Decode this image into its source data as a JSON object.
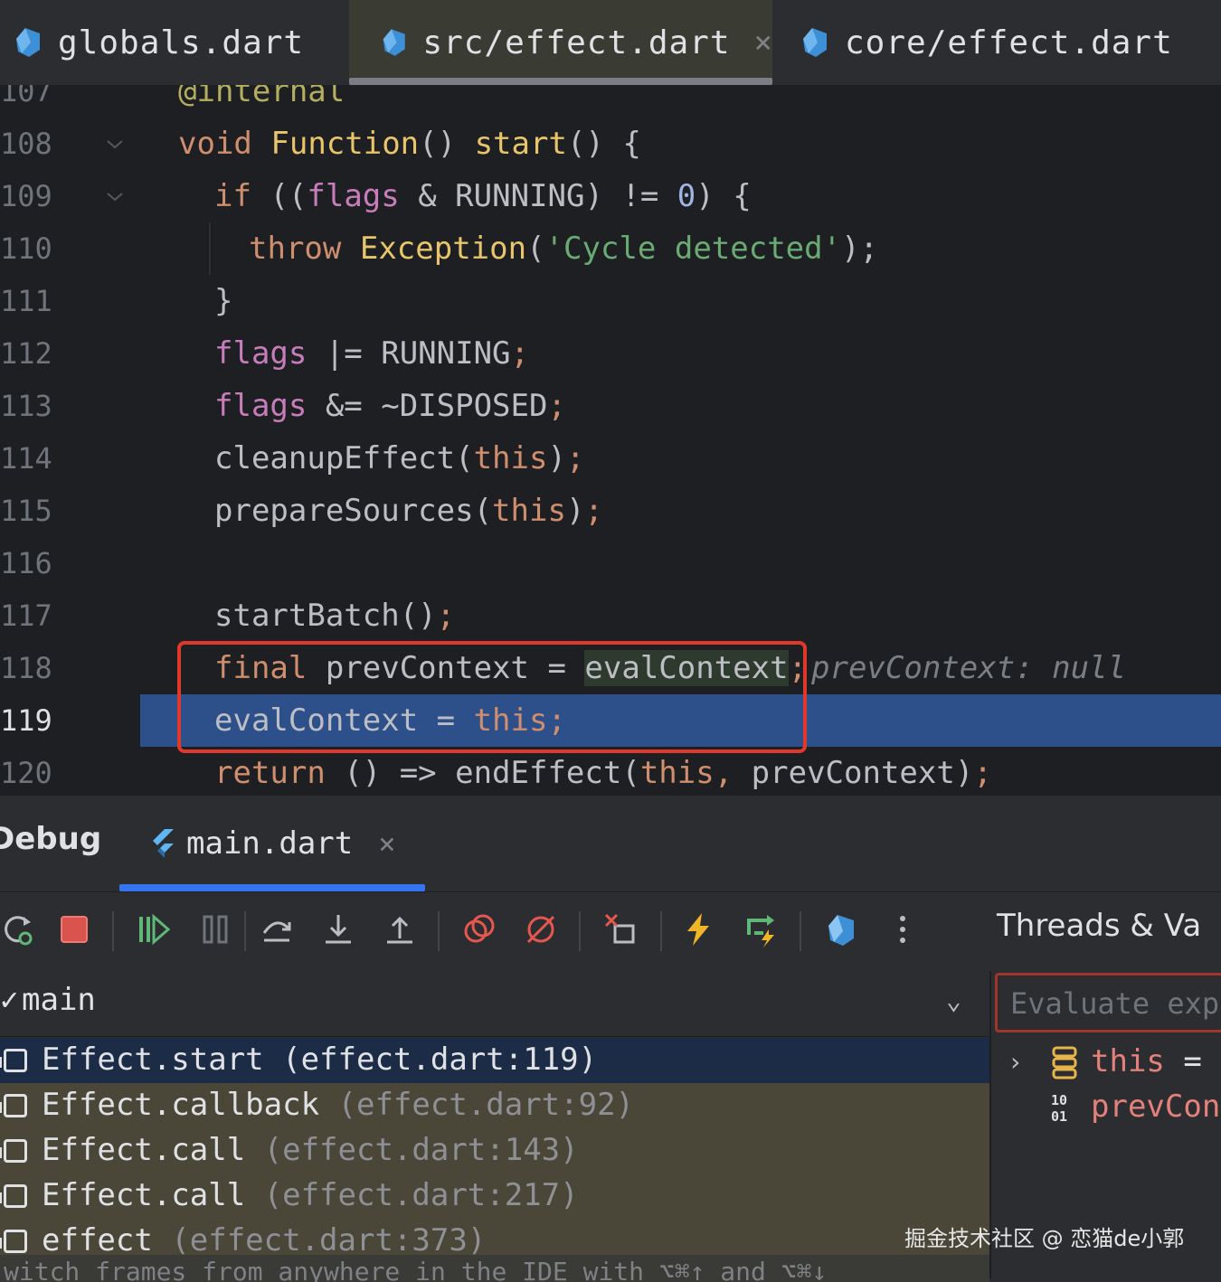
{
  "editor_tabs": [
    {
      "label": "globals.dart",
      "active": false
    },
    {
      "label": "src/effect.dart",
      "active": true,
      "close": "×"
    },
    {
      "label": "core/effect.dart",
      "active": false
    }
  ],
  "gutter": {
    "lines": [
      "107",
      "108",
      "109",
      "110",
      "111",
      "112",
      "113",
      "114",
      "115",
      "116",
      "117",
      "118",
      "119",
      "120"
    ],
    "current_line": "119"
  },
  "code": {
    "l107": {
      "ann": "@internal"
    },
    "l108": {
      "kw": "void",
      "type": "Function",
      "paren": "()",
      "fn": "start",
      "rest": "() {"
    },
    "l109": {
      "kw": "if",
      "p1": "((",
      "fld": "flags",
      "op": " & RUNNING) != ",
      "num": "0",
      "rest": ") {"
    },
    "l110": {
      "kw": "throw",
      "type": "Exception",
      "p1": "(",
      "str": "'Cycle detected'",
      "rest": ");"
    },
    "l111": {
      "text": "}"
    },
    "l112": {
      "fld": "flags",
      "rest": " |= RUNNING",
      "semi": ";"
    },
    "l113": {
      "fld": "flags",
      "rest": " &= ~DISPOSED",
      "semi": ";"
    },
    "l114": {
      "pre": "cleanupEffect(",
      "kw": "this",
      "rest": ")",
      "semi": ";"
    },
    "l115": {
      "pre": "prepareSources(",
      "kw": "this",
      "rest": ")",
      "semi": ";"
    },
    "l117": {
      "pre": "startBatch()",
      "semi": ";"
    },
    "l118": {
      "kw": "final",
      "mid": " prevContext = ",
      "hl": "evalContext",
      "semi": ";",
      "inline_hint": "prevContext: null"
    },
    "l119": {
      "pre": "evalContext = ",
      "kw": "this",
      "semi": ";"
    },
    "l120": {
      "kw": "return",
      "mid": " () => endEffect(",
      "kw2": "this",
      "comma": ",",
      "rest": " prevContext)",
      "semi": ";"
    }
  },
  "debug": {
    "title": "Debug",
    "session_tab": "main.dart",
    "session_close": "×",
    "threads_label": "Threads & Va",
    "thread_selector": "main",
    "frames": [
      {
        "name": "Effect.start ",
        "loc": "(effect.dart:119)",
        "selected": true
      },
      {
        "name": "Effect.callback ",
        "loc": "(effect.dart:92)",
        "selected": false
      },
      {
        "name": "Effect.call ",
        "loc": "(effect.dart:143)",
        "selected": false
      },
      {
        "name": "Effect.call ",
        "loc": "(effect.dart:217)",
        "selected": false
      },
      {
        "name": "effect ",
        "loc": "(effect.dart:373)",
        "selected": false
      }
    ],
    "hint": "witch frames from anywhere in the IDE with ⌥⌘↑ and ⌥⌘↓",
    "evaluate_placeholder": "Evaluate expr",
    "variables": [
      {
        "name": "this",
        "eq": " =",
        "icon": "object-icon"
      },
      {
        "name": "prevCon",
        "eq": "",
        "icon": "binary-icon"
      }
    ]
  },
  "watermark": "掘金技术社区 @ 恋猫de小郭",
  "colors": {
    "accent": "#3574f0",
    "highlight_line": "#2d4f8a",
    "red_box": "#e0392c",
    "selected_frame": "#1c2c47"
  }
}
